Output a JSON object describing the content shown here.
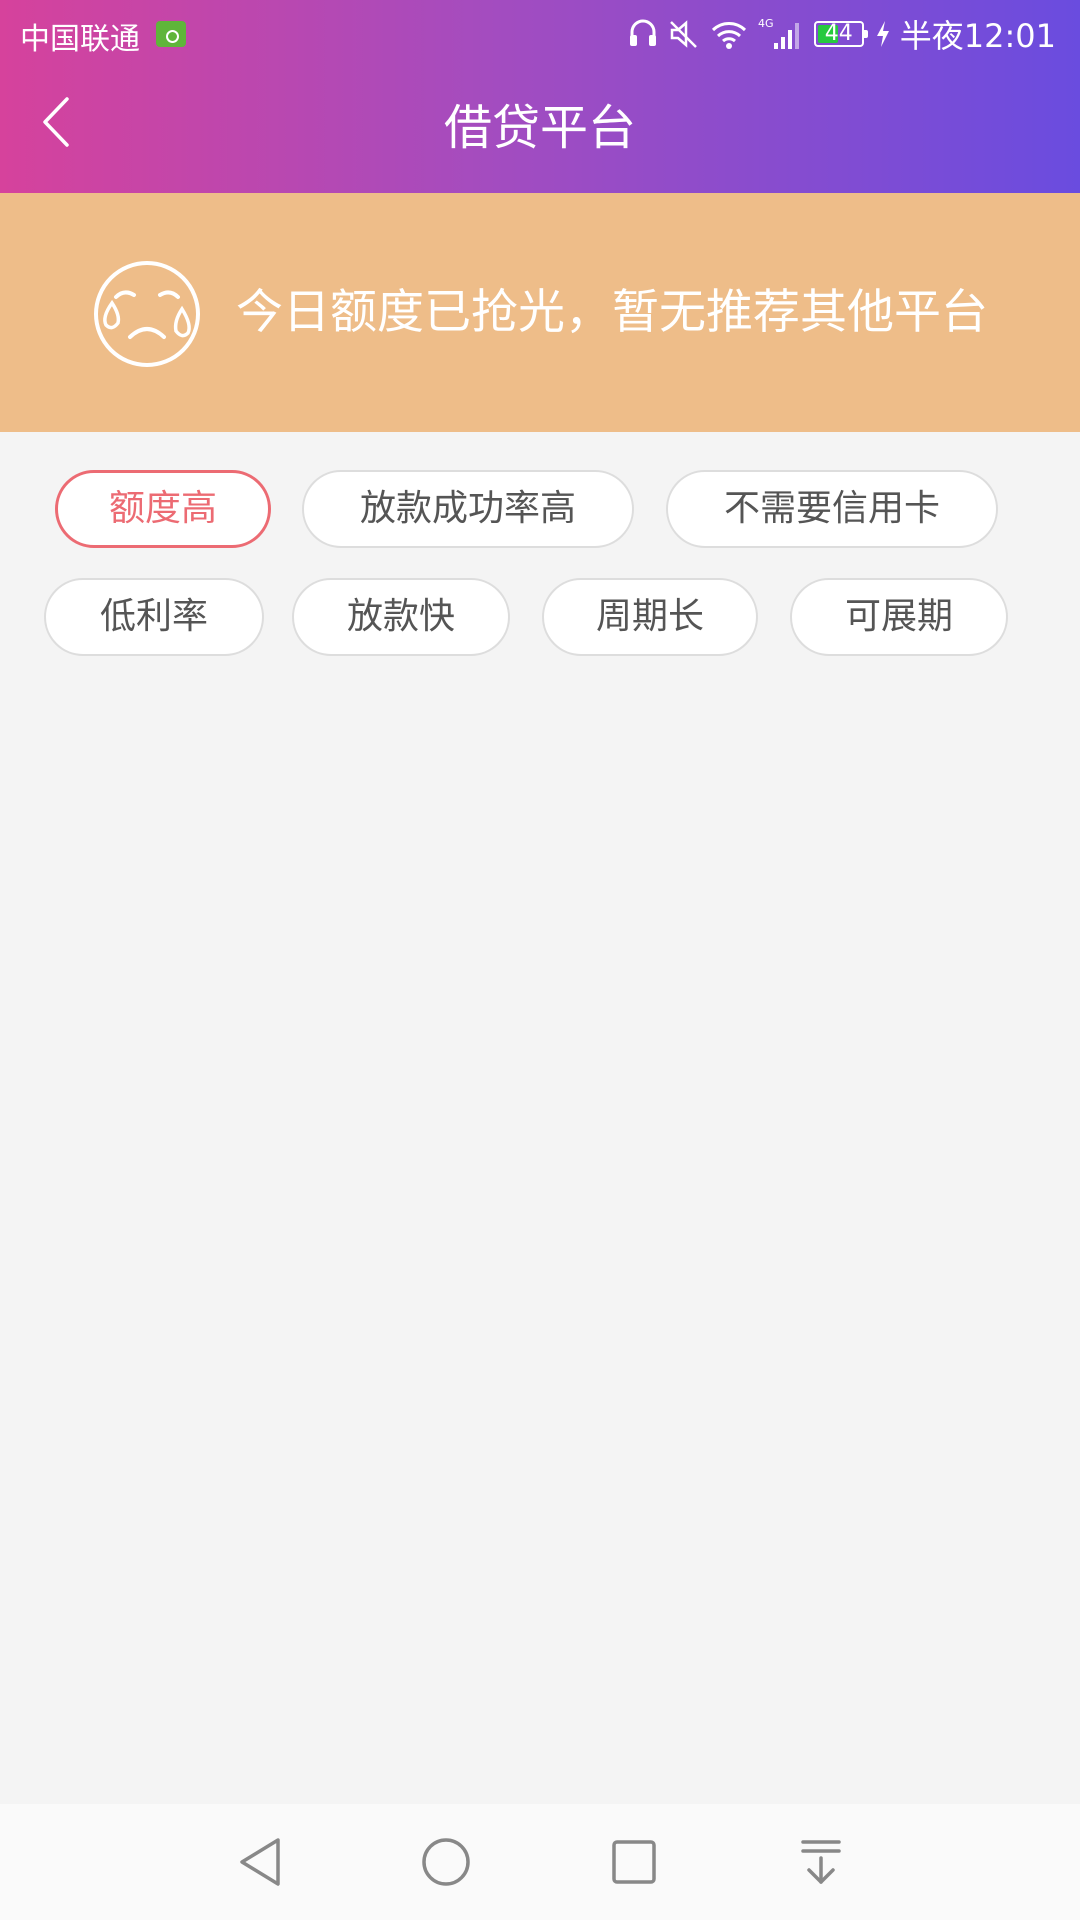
{
  "status_bar": {
    "carrier": "中国联通",
    "battery_level": "44",
    "time": "半夜12:01",
    "network": "4G"
  },
  "header": {
    "title": "借贷平台"
  },
  "notice": {
    "text": "今日额度已抢光，暂无推荐其他平台"
  },
  "filters": {
    "row1": [
      {
        "label": "额度高",
        "active": true
      },
      {
        "label": "放款成功率高",
        "active": false
      },
      {
        "label": "不需要信用卡",
        "active": false
      }
    ],
    "row2": [
      {
        "label": "低利率",
        "active": false
      },
      {
        "label": "放款快",
        "active": false
      },
      {
        "label": "周期长",
        "active": false
      },
      {
        "label": "可展期",
        "active": false
      }
    ]
  },
  "colors": {
    "header_gradient_start": "#d6429c",
    "header_gradient_end": "#6a4cdf",
    "banner": "#eebd89",
    "active_chip": "#ec6b73"
  }
}
